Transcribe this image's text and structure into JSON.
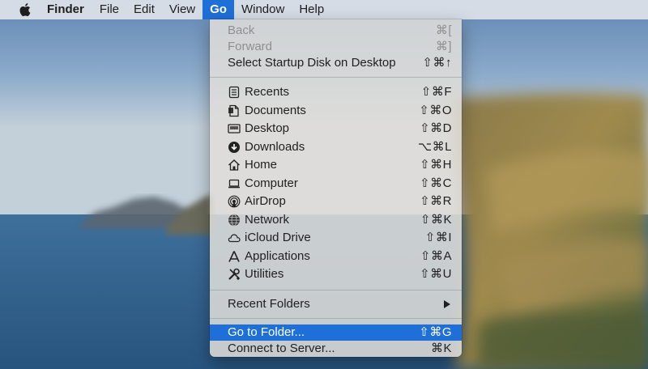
{
  "menubar": {
    "apple_icon": "apple-logo-icon",
    "app_name": "Finder",
    "items": [
      {
        "label": "File"
      },
      {
        "label": "Edit"
      },
      {
        "label": "View"
      },
      {
        "label": "Go"
      },
      {
        "label": "Window"
      },
      {
        "label": "Help"
      }
    ],
    "active_item": "Go"
  },
  "go_menu": {
    "group1": [
      {
        "label": "Back",
        "shortcut": "⌘[",
        "enabled": false
      },
      {
        "label": "Forward",
        "shortcut": "⌘]",
        "enabled": false
      },
      {
        "label": "Select Startup Disk on Desktop",
        "shortcut": "⇧⌘↑",
        "enabled": true
      }
    ],
    "group2": [
      {
        "label": "Recents",
        "shortcut": "⇧⌘F",
        "icon": "recents-icon"
      },
      {
        "label": "Documents",
        "shortcut": "⇧⌘O",
        "icon": "documents-icon"
      },
      {
        "label": "Desktop",
        "shortcut": "⇧⌘D",
        "icon": "desktop-icon"
      },
      {
        "label": "Downloads",
        "shortcut": "⌥⌘L",
        "icon": "downloads-icon"
      },
      {
        "label": "Home",
        "shortcut": "⇧⌘H",
        "icon": "home-icon"
      },
      {
        "label": "Computer",
        "shortcut": "⇧⌘C",
        "icon": "computer-icon"
      },
      {
        "label": "AirDrop",
        "shortcut": "⇧⌘R",
        "icon": "airdrop-icon"
      },
      {
        "label": "Network",
        "shortcut": "⇧⌘K",
        "icon": "network-icon"
      },
      {
        "label": "iCloud Drive",
        "shortcut": "⇧⌘I",
        "icon": "icloud-icon"
      },
      {
        "label": "Applications",
        "shortcut": "⇧⌘A",
        "icon": "applications-icon"
      },
      {
        "label": "Utilities",
        "shortcut": "⇧⌘U",
        "icon": "utilities-icon"
      }
    ],
    "group3": [
      {
        "label": "Recent Folders",
        "submenu": true,
        "icon": "submenu-arrow-icon"
      }
    ],
    "group4": [
      {
        "label": "Go to Folder...",
        "shortcut": "⇧⌘G",
        "highlighted": true
      },
      {
        "label": "Connect to Server...",
        "shortcut": "⌘K"
      }
    ]
  },
  "colors": {
    "highlight": "#1f6fd9",
    "disabled_text": "#8f8f8f",
    "menu_text": "#1f1f1f"
  }
}
